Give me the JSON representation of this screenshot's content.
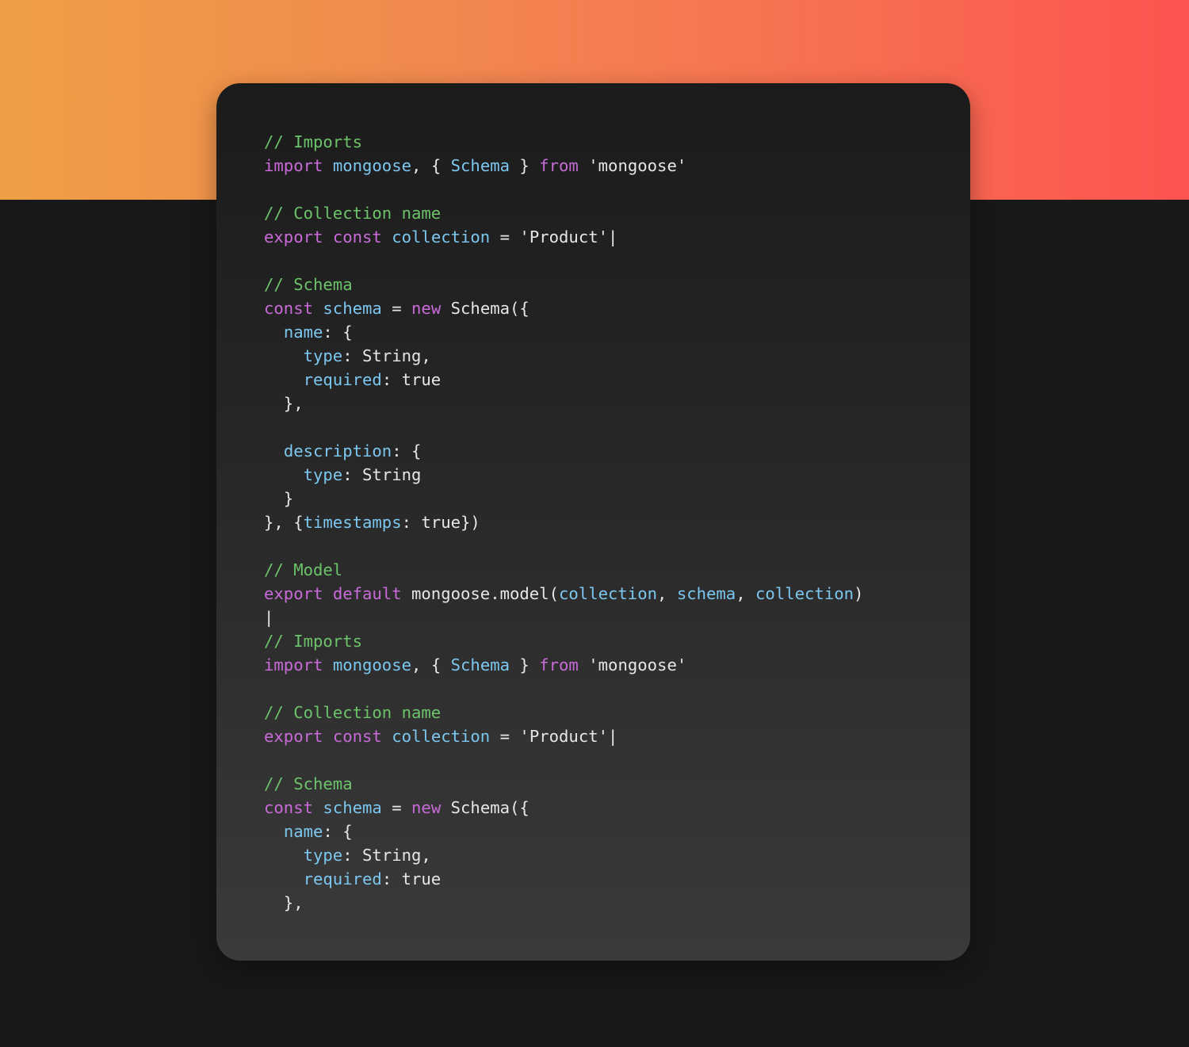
{
  "colors": {
    "comment": "#6cc36a",
    "keyword": "#c86bd8",
    "identifier": "#7cc7f0",
    "plain": "#e6e6e6",
    "card_background": "#262626",
    "page_background": "#181818",
    "gradient_start": "#ee9f45",
    "gradient_end": "#fc5351"
  },
  "code_lines": [
    [
      {
        "t": "comment",
        "v": "// Imports"
      }
    ],
    [
      {
        "t": "keyword",
        "v": "import"
      },
      {
        "t": "plain",
        "v": " "
      },
      {
        "t": "ident",
        "v": "mongoose"
      },
      {
        "t": "plain",
        "v": ", { "
      },
      {
        "t": "ident",
        "v": "Schema"
      },
      {
        "t": "plain",
        "v": " } "
      },
      {
        "t": "keyword",
        "v": "from"
      },
      {
        "t": "plain",
        "v": " "
      },
      {
        "t": "string",
        "v": "'mongoose'"
      }
    ],
    [],
    [
      {
        "t": "comment",
        "v": "// Collection name"
      }
    ],
    [
      {
        "t": "keyword",
        "v": "export"
      },
      {
        "t": "plain",
        "v": " "
      },
      {
        "t": "keyword",
        "v": "const"
      },
      {
        "t": "plain",
        "v": " "
      },
      {
        "t": "ident",
        "v": "collection"
      },
      {
        "t": "plain",
        "v": " = "
      },
      {
        "t": "string",
        "v": "'Product'"
      },
      {
        "t": "plain",
        "v": "|"
      }
    ],
    [],
    [
      {
        "t": "comment",
        "v": "// Schema"
      }
    ],
    [
      {
        "t": "keyword",
        "v": "const"
      },
      {
        "t": "plain",
        "v": " "
      },
      {
        "t": "ident",
        "v": "schema"
      },
      {
        "t": "plain",
        "v": " = "
      },
      {
        "t": "keyword",
        "v": "new"
      },
      {
        "t": "plain",
        "v": " Schema({"
      }
    ],
    [
      {
        "t": "plain",
        "v": "  "
      },
      {
        "t": "ident",
        "v": "name"
      },
      {
        "t": "plain",
        "v": ": {"
      }
    ],
    [
      {
        "t": "plain",
        "v": "    "
      },
      {
        "t": "ident",
        "v": "type"
      },
      {
        "t": "plain",
        "v": ": String,"
      }
    ],
    [
      {
        "t": "plain",
        "v": "    "
      },
      {
        "t": "ident",
        "v": "required"
      },
      {
        "t": "plain",
        "v": ": true"
      }
    ],
    [
      {
        "t": "plain",
        "v": "  },"
      }
    ],
    [],
    [
      {
        "t": "plain",
        "v": "  "
      },
      {
        "t": "ident",
        "v": "description"
      },
      {
        "t": "plain",
        "v": ": {"
      }
    ],
    [
      {
        "t": "plain",
        "v": "    "
      },
      {
        "t": "ident",
        "v": "type"
      },
      {
        "t": "plain",
        "v": ": String"
      }
    ],
    [
      {
        "t": "plain",
        "v": "  }"
      }
    ],
    [
      {
        "t": "plain",
        "v": "}, {"
      },
      {
        "t": "ident",
        "v": "timestamps"
      },
      {
        "t": "plain",
        "v": ": true})"
      }
    ],
    [],
    [
      {
        "t": "comment",
        "v": "// Model"
      }
    ],
    [
      {
        "t": "keyword",
        "v": "export"
      },
      {
        "t": "plain",
        "v": " "
      },
      {
        "t": "keyword",
        "v": "default"
      },
      {
        "t": "plain",
        "v": " mongoose.model("
      },
      {
        "t": "ident",
        "v": "collection"
      },
      {
        "t": "plain",
        "v": ", "
      },
      {
        "t": "ident",
        "v": "schema"
      },
      {
        "t": "plain",
        "v": ", "
      },
      {
        "t": "ident",
        "v": "collection"
      },
      {
        "t": "plain",
        "v": ")"
      }
    ],
    [
      {
        "t": "plain",
        "v": "|"
      }
    ],
    [
      {
        "t": "comment",
        "v": "// Imports"
      }
    ],
    [
      {
        "t": "keyword",
        "v": "import"
      },
      {
        "t": "plain",
        "v": " "
      },
      {
        "t": "ident",
        "v": "mongoose"
      },
      {
        "t": "plain",
        "v": ", { "
      },
      {
        "t": "ident",
        "v": "Schema"
      },
      {
        "t": "plain",
        "v": " } "
      },
      {
        "t": "keyword",
        "v": "from"
      },
      {
        "t": "plain",
        "v": " "
      },
      {
        "t": "string",
        "v": "'mongoose'"
      }
    ],
    [],
    [
      {
        "t": "comment",
        "v": "// Collection name"
      }
    ],
    [
      {
        "t": "keyword",
        "v": "export"
      },
      {
        "t": "plain",
        "v": " "
      },
      {
        "t": "keyword",
        "v": "const"
      },
      {
        "t": "plain",
        "v": " "
      },
      {
        "t": "ident",
        "v": "collection"
      },
      {
        "t": "plain",
        "v": " = "
      },
      {
        "t": "string",
        "v": "'Product'"
      },
      {
        "t": "plain",
        "v": "|"
      }
    ],
    [],
    [
      {
        "t": "comment",
        "v": "// Schema"
      }
    ],
    [
      {
        "t": "keyword",
        "v": "const"
      },
      {
        "t": "plain",
        "v": " "
      },
      {
        "t": "ident",
        "v": "schema"
      },
      {
        "t": "plain",
        "v": " = "
      },
      {
        "t": "keyword",
        "v": "new"
      },
      {
        "t": "plain",
        "v": " Schema({"
      }
    ],
    [
      {
        "t": "plain",
        "v": "  "
      },
      {
        "t": "ident",
        "v": "name"
      },
      {
        "t": "plain",
        "v": ": {"
      }
    ],
    [
      {
        "t": "plain",
        "v": "    "
      },
      {
        "t": "ident",
        "v": "type"
      },
      {
        "t": "plain",
        "v": ": String,"
      }
    ],
    [
      {
        "t": "plain",
        "v": "    "
      },
      {
        "t": "ident",
        "v": "required"
      },
      {
        "t": "plain",
        "v": ": true"
      }
    ],
    [
      {
        "t": "plain",
        "v": "  },"
      }
    ]
  ]
}
